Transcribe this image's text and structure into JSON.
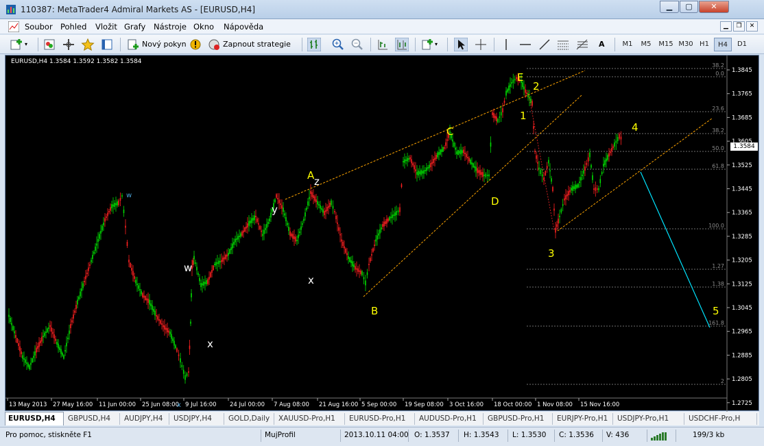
{
  "window": {
    "title": "110387: MetaTrader4 Admiral Markets AS - [EURUSD,H4]"
  },
  "menu": [
    "Soubor",
    "Pohled",
    "Vložit",
    "Grafy",
    "Nástroje",
    "Okno",
    "Nápověda"
  ],
  "toolbar": {
    "new_order": "Nový pokyn",
    "auto_trading": "Zapnout strategie",
    "text_tool": "A"
  },
  "timeframes": [
    "M1",
    "M5",
    "M15",
    "M30",
    "H1",
    "H4",
    "D1"
  ],
  "active_timeframe": "H4",
  "chart": {
    "header": "EURUSD,H4  1.3584 1.3592 1.3582 1.3584",
    "current_price": "1.3584",
    "price_ticks": [
      "1.3845",
      "1.3765",
      "1.3685",
      "1.3605",
      "1.3525",
      "1.3445",
      "1.3365",
      "1.3285",
      "1.3205",
      "1.3125",
      "1.3045",
      "1.2965",
      "1.2885",
      "1.2805",
      "1.2725"
    ],
    "date_ticks": [
      "13 May 2013",
      "27 May 16:00",
      "11 Jun 00:00",
      "25 Jun 08:00",
      "9 Jul 16:00",
      "24 Jul 00:00",
      "7 Aug 08:00",
      "21 Aug 16:00",
      "5 Sep 00:00",
      "19 Sep 08:00",
      "3 Oct 16:00",
      "18 Oct 00:00",
      "1 Nov 08:00",
      "15 Nov 16:00"
    ],
    "fib_levels": [
      "38.2",
      "0.0",
      "23.6",
      "38.2",
      "50.0",
      "61.8",
      "100.0",
      "1.27",
      "1.38",
      "161.8",
      "2"
    ],
    "wave_labels": [
      {
        "text": "E",
        "color": "#ffff00"
      },
      {
        "text": "2",
        "color": "#ffff00"
      },
      {
        "text": "1",
        "color": "#ffff00"
      },
      {
        "text": "C",
        "color": "#ffff00"
      },
      {
        "text": "4",
        "color": "#ffff00"
      },
      {
        "text": "A",
        "color": "#ffff00"
      },
      {
        "text": "z",
        "color": "#ffffff"
      },
      {
        "text": "y",
        "color": "#ffffff"
      },
      {
        "text": "D",
        "color": "#ffff00"
      },
      {
        "text": "w",
        "color": "#4aa3d8"
      },
      {
        "text": "w",
        "color": "#ffffff"
      },
      {
        "text": "x",
        "color": "#ffffff"
      },
      {
        "text": "3",
        "color": "#ffff00"
      },
      {
        "text": "B",
        "color": "#ffff00"
      },
      {
        "text": "x",
        "color": "#ffffff"
      },
      {
        "text": "5",
        "color": "#ffff00"
      },
      {
        "text": "x",
        "color": "#4aa3d8"
      }
    ]
  },
  "tabs": [
    "EURUSD,H4",
    "GBPUSD,H4",
    "AUDJPY,H4",
    "USDJPY,H4",
    "GOLD,Daily",
    "XAUUSD-Pro,H1",
    "EURUSD-Pro,H1",
    "AUDUSD-Pro,H1",
    "GBPUSD-Pro,H1",
    "EURJPY-Pro,H1",
    "USDJPY-Pro,H1",
    "USDCHF-Pro,H"
  ],
  "status": {
    "help": "Pro pomoc, stiskněte F1",
    "profile": "MujProfil",
    "datetime": "2013.10.11 04:00",
    "open": "O: 1.3537",
    "high": "H: 1.3543",
    "low": "L: 1.3530",
    "close": "C: 1.3536",
    "volume": "V: 436",
    "traffic": "199/3 kb"
  },
  "colors": {
    "bull": "#00e000",
    "bear": "#ff2020",
    "wave": "#ffff00",
    "trendline": "#ffa500",
    "projection": "#00e5ff"
  }
}
